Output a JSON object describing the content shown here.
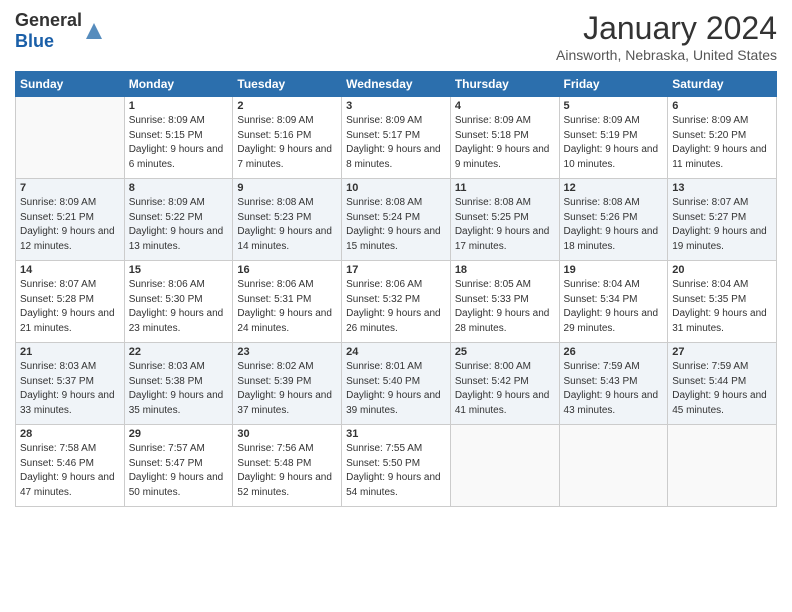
{
  "app": {
    "logo_general": "General",
    "logo_blue": "Blue"
  },
  "header": {
    "month_title": "January 2024",
    "subtitle": "Ainsworth, Nebraska, United States"
  },
  "days_of_week": [
    "Sunday",
    "Monday",
    "Tuesday",
    "Wednesday",
    "Thursday",
    "Friday",
    "Saturday"
  ],
  "weeks": [
    [
      {
        "day": "",
        "sunrise": "",
        "sunset": "",
        "daylight": ""
      },
      {
        "day": "1",
        "sunrise": "Sunrise: 8:09 AM",
        "sunset": "Sunset: 5:15 PM",
        "daylight": "Daylight: 9 hours and 6 minutes."
      },
      {
        "day": "2",
        "sunrise": "Sunrise: 8:09 AM",
        "sunset": "Sunset: 5:16 PM",
        "daylight": "Daylight: 9 hours and 7 minutes."
      },
      {
        "day": "3",
        "sunrise": "Sunrise: 8:09 AM",
        "sunset": "Sunset: 5:17 PM",
        "daylight": "Daylight: 9 hours and 8 minutes."
      },
      {
        "day": "4",
        "sunrise": "Sunrise: 8:09 AM",
        "sunset": "Sunset: 5:18 PM",
        "daylight": "Daylight: 9 hours and 9 minutes."
      },
      {
        "day": "5",
        "sunrise": "Sunrise: 8:09 AM",
        "sunset": "Sunset: 5:19 PM",
        "daylight": "Daylight: 9 hours and 10 minutes."
      },
      {
        "day": "6",
        "sunrise": "Sunrise: 8:09 AM",
        "sunset": "Sunset: 5:20 PM",
        "daylight": "Daylight: 9 hours and 11 minutes."
      }
    ],
    [
      {
        "day": "7",
        "sunrise": "Sunrise: 8:09 AM",
        "sunset": "Sunset: 5:21 PM",
        "daylight": "Daylight: 9 hours and 12 minutes."
      },
      {
        "day": "8",
        "sunrise": "Sunrise: 8:09 AM",
        "sunset": "Sunset: 5:22 PM",
        "daylight": "Daylight: 9 hours and 13 minutes."
      },
      {
        "day": "9",
        "sunrise": "Sunrise: 8:08 AM",
        "sunset": "Sunset: 5:23 PM",
        "daylight": "Daylight: 9 hours and 14 minutes."
      },
      {
        "day": "10",
        "sunrise": "Sunrise: 8:08 AM",
        "sunset": "Sunset: 5:24 PM",
        "daylight": "Daylight: 9 hours and 15 minutes."
      },
      {
        "day": "11",
        "sunrise": "Sunrise: 8:08 AM",
        "sunset": "Sunset: 5:25 PM",
        "daylight": "Daylight: 9 hours and 17 minutes."
      },
      {
        "day": "12",
        "sunrise": "Sunrise: 8:08 AM",
        "sunset": "Sunset: 5:26 PM",
        "daylight": "Daylight: 9 hours and 18 minutes."
      },
      {
        "day": "13",
        "sunrise": "Sunrise: 8:07 AM",
        "sunset": "Sunset: 5:27 PM",
        "daylight": "Daylight: 9 hours and 19 minutes."
      }
    ],
    [
      {
        "day": "14",
        "sunrise": "Sunrise: 8:07 AM",
        "sunset": "Sunset: 5:28 PM",
        "daylight": "Daylight: 9 hours and 21 minutes."
      },
      {
        "day": "15",
        "sunrise": "Sunrise: 8:06 AM",
        "sunset": "Sunset: 5:30 PM",
        "daylight": "Daylight: 9 hours and 23 minutes."
      },
      {
        "day": "16",
        "sunrise": "Sunrise: 8:06 AM",
        "sunset": "Sunset: 5:31 PM",
        "daylight": "Daylight: 9 hours and 24 minutes."
      },
      {
        "day": "17",
        "sunrise": "Sunrise: 8:06 AM",
        "sunset": "Sunset: 5:32 PM",
        "daylight": "Daylight: 9 hours and 26 minutes."
      },
      {
        "day": "18",
        "sunrise": "Sunrise: 8:05 AM",
        "sunset": "Sunset: 5:33 PM",
        "daylight": "Daylight: 9 hours and 28 minutes."
      },
      {
        "day": "19",
        "sunrise": "Sunrise: 8:04 AM",
        "sunset": "Sunset: 5:34 PM",
        "daylight": "Daylight: 9 hours and 29 minutes."
      },
      {
        "day": "20",
        "sunrise": "Sunrise: 8:04 AM",
        "sunset": "Sunset: 5:35 PM",
        "daylight": "Daylight: 9 hours and 31 minutes."
      }
    ],
    [
      {
        "day": "21",
        "sunrise": "Sunrise: 8:03 AM",
        "sunset": "Sunset: 5:37 PM",
        "daylight": "Daylight: 9 hours and 33 minutes."
      },
      {
        "day": "22",
        "sunrise": "Sunrise: 8:03 AM",
        "sunset": "Sunset: 5:38 PM",
        "daylight": "Daylight: 9 hours and 35 minutes."
      },
      {
        "day": "23",
        "sunrise": "Sunrise: 8:02 AM",
        "sunset": "Sunset: 5:39 PM",
        "daylight": "Daylight: 9 hours and 37 minutes."
      },
      {
        "day": "24",
        "sunrise": "Sunrise: 8:01 AM",
        "sunset": "Sunset: 5:40 PM",
        "daylight": "Daylight: 9 hours and 39 minutes."
      },
      {
        "day": "25",
        "sunrise": "Sunrise: 8:00 AM",
        "sunset": "Sunset: 5:42 PM",
        "daylight": "Daylight: 9 hours and 41 minutes."
      },
      {
        "day": "26",
        "sunrise": "Sunrise: 7:59 AM",
        "sunset": "Sunset: 5:43 PM",
        "daylight": "Daylight: 9 hours and 43 minutes."
      },
      {
        "day": "27",
        "sunrise": "Sunrise: 7:59 AM",
        "sunset": "Sunset: 5:44 PM",
        "daylight": "Daylight: 9 hours and 45 minutes."
      }
    ],
    [
      {
        "day": "28",
        "sunrise": "Sunrise: 7:58 AM",
        "sunset": "Sunset: 5:46 PM",
        "daylight": "Daylight: 9 hours and 47 minutes."
      },
      {
        "day": "29",
        "sunrise": "Sunrise: 7:57 AM",
        "sunset": "Sunset: 5:47 PM",
        "daylight": "Daylight: 9 hours and 50 minutes."
      },
      {
        "day": "30",
        "sunrise": "Sunrise: 7:56 AM",
        "sunset": "Sunset: 5:48 PM",
        "daylight": "Daylight: 9 hours and 52 minutes."
      },
      {
        "day": "31",
        "sunrise": "Sunrise: 7:55 AM",
        "sunset": "Sunset: 5:50 PM",
        "daylight": "Daylight: 9 hours and 54 minutes."
      },
      {
        "day": "",
        "sunrise": "",
        "sunset": "",
        "daylight": ""
      },
      {
        "day": "",
        "sunrise": "",
        "sunset": "",
        "daylight": ""
      },
      {
        "day": "",
        "sunrise": "",
        "sunset": "",
        "daylight": ""
      }
    ]
  ]
}
